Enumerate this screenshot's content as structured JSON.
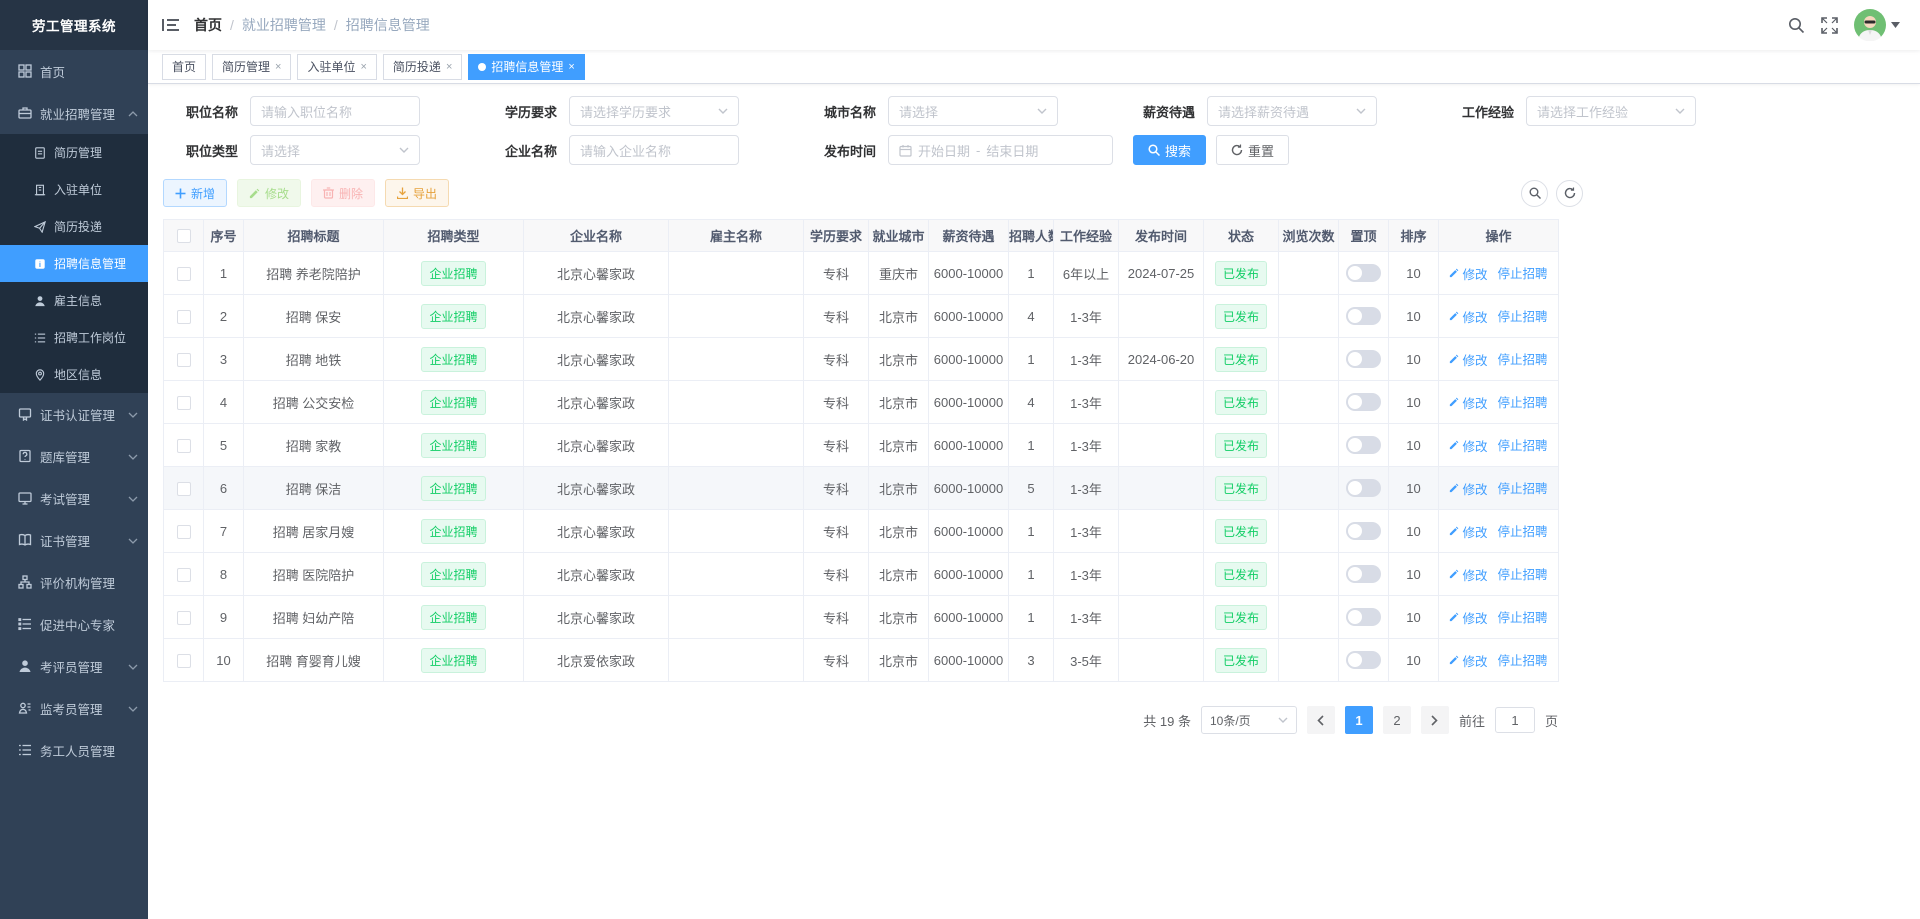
{
  "app": {
    "title": "劳工管理系统"
  },
  "theme": {
    "primary": "#409eff",
    "success": "#13ce66",
    "sidebar_bg": "#304156",
    "submenu_bg": "#1f2d3d"
  },
  "navbar": {
    "breadcrumb": [
      "首页",
      "就业招聘管理",
      "招聘信息管理"
    ],
    "icons": [
      "search-icon",
      "fullscreen-icon",
      "avatar",
      "caret-down-icon"
    ]
  },
  "tags": [
    {
      "label": "首页",
      "active": false,
      "closable": false
    },
    {
      "label": "简历管理",
      "active": false,
      "closable": true
    },
    {
      "label": "入驻单位",
      "active": false,
      "closable": true
    },
    {
      "label": "简历投递",
      "active": false,
      "closable": true
    },
    {
      "label": "招聘信息管理",
      "active": true,
      "closable": true
    }
  ],
  "sidebar": {
    "items": [
      {
        "label": "首页",
        "icon": "dashboard-icon",
        "chevron": null,
        "children": []
      },
      {
        "label": "就业招聘管理",
        "icon": "briefcase-icon",
        "chevron": "up",
        "children": [
          {
            "label": "简历管理",
            "icon": "resume-icon",
            "active": false
          },
          {
            "label": "入驻单位",
            "icon": "building-icon",
            "active": false
          },
          {
            "label": "简历投递",
            "icon": "send-icon",
            "active": false
          },
          {
            "label": "招聘信息管理",
            "icon": "info-icon",
            "active": true
          },
          {
            "label": "雇主信息",
            "icon": "user-icon",
            "active": false
          },
          {
            "label": "招聘工作岗位",
            "icon": "list-icon",
            "active": false
          },
          {
            "label": "地区信息",
            "icon": "region-icon",
            "active": false
          }
        ]
      },
      {
        "label": "证书认证管理",
        "icon": "certificate-icon",
        "chevron": "down",
        "children": []
      },
      {
        "label": "题库管理",
        "icon": "question-bank-icon",
        "chevron": "down",
        "children": []
      },
      {
        "label": "考试管理",
        "icon": "exam-icon",
        "chevron": "down",
        "children": []
      },
      {
        "label": "证书管理",
        "icon": "book-icon",
        "chevron": "down",
        "children": []
      },
      {
        "label": "评价机构管理",
        "icon": "org-chart-icon",
        "chevron": null,
        "children": []
      },
      {
        "label": "促进中心专家",
        "icon": "experts-icon",
        "chevron": null,
        "children": []
      },
      {
        "label": "考评员管理",
        "icon": "assessor-icon",
        "chevron": "down",
        "children": []
      },
      {
        "label": "监考员管理",
        "icon": "proctor-icon",
        "chevron": "down",
        "children": []
      },
      {
        "label": "务工人员管理",
        "icon": "workers-icon",
        "chevron": null,
        "children": []
      }
    ]
  },
  "filters": {
    "position_name": {
      "label": "职位名称",
      "placeholder": "请输入职位名称"
    },
    "education": {
      "label": "学历要求",
      "placeholder": "请选择学历要求"
    },
    "city": {
      "label": "城市名称",
      "placeholder": "请选择"
    },
    "salary": {
      "label": "薪资待遇",
      "placeholder": "请选择薪资待遇"
    },
    "experience": {
      "label": "工作经验",
      "placeholder": "请选择工作经验"
    },
    "position_type": {
      "label": "职位类型",
      "placeholder": "请选择"
    },
    "company": {
      "label": "企业名称",
      "placeholder": "请输入企业名称"
    },
    "publish_time": {
      "label": "发布时间",
      "start": "开始日期",
      "separator": "-",
      "end": "结束日期"
    },
    "search_label": "搜索",
    "reset_label": "重置"
  },
  "toolbar": {
    "add": "新增",
    "edit": "修改",
    "delete": "删除",
    "export": "导出"
  },
  "table": {
    "columns": [
      {
        "key": "index",
        "label": "序号"
      },
      {
        "key": "title",
        "label": "招聘标题"
      },
      {
        "key": "type",
        "label": "招聘类型"
      },
      {
        "key": "company",
        "label": "企业名称"
      },
      {
        "key": "employer",
        "label": "雇主名称"
      },
      {
        "key": "edu",
        "label": "学历要求"
      },
      {
        "key": "city",
        "label": "就业城市"
      },
      {
        "key": "salary",
        "label": "薪资待遇"
      },
      {
        "key": "count",
        "label": "招聘人数"
      },
      {
        "key": "exp",
        "label": "工作经验"
      },
      {
        "key": "date",
        "label": "发布时间"
      },
      {
        "key": "status",
        "label": "状态"
      },
      {
        "key": "views",
        "label": "浏览次数"
      },
      {
        "key": "top",
        "label": "置顶"
      },
      {
        "key": "sort",
        "label": "排序"
      },
      {
        "key": "ops",
        "label": "操作"
      }
    ],
    "ops": {
      "edit": "修改",
      "stop": "停止招聘"
    },
    "rows": [
      {
        "index": "1",
        "title": "招聘 养老院陪护",
        "type": "企业招聘",
        "company": "北京心馨家政",
        "employer": "",
        "edu": "专科",
        "city": "重庆市",
        "salary": "6000-10000",
        "count": "1",
        "exp": "6年以上",
        "date": "2024-07-25",
        "status": "已发布",
        "views": "",
        "sort": "10",
        "highlighted": false
      },
      {
        "index": "2",
        "title": "招聘 保安",
        "type": "企业招聘",
        "company": "北京心馨家政",
        "employer": "",
        "edu": "专科",
        "city": "北京市",
        "salary": "6000-10000",
        "count": "4",
        "exp": "1-3年",
        "date": "",
        "status": "已发布",
        "views": "",
        "sort": "10",
        "highlighted": false
      },
      {
        "index": "3",
        "title": "招聘 地铁",
        "type": "企业招聘",
        "company": "北京心馨家政",
        "employer": "",
        "edu": "专科",
        "city": "北京市",
        "salary": "6000-10000",
        "count": "1",
        "exp": "1-3年",
        "date": "2024-06-20",
        "status": "已发布",
        "views": "",
        "sort": "10",
        "highlighted": false
      },
      {
        "index": "4",
        "title": "招聘 公交安检",
        "type": "企业招聘",
        "company": "北京心馨家政",
        "employer": "",
        "edu": "专科",
        "city": "北京市",
        "salary": "6000-10000",
        "count": "4",
        "exp": "1-3年",
        "date": "",
        "status": "已发布",
        "views": "",
        "sort": "10",
        "highlighted": false
      },
      {
        "index": "5",
        "title": "招聘 家教",
        "type": "企业招聘",
        "company": "北京心馨家政",
        "employer": "",
        "edu": "专科",
        "city": "北京市",
        "salary": "6000-10000",
        "count": "1",
        "exp": "1-3年",
        "date": "",
        "status": "已发布",
        "views": "",
        "sort": "10",
        "highlighted": false
      },
      {
        "index": "6",
        "title": "招聘 保洁",
        "type": "企业招聘",
        "company": "北京心馨家政",
        "employer": "",
        "edu": "专科",
        "city": "北京市",
        "salary": "6000-10000",
        "count": "5",
        "exp": "1-3年",
        "date": "",
        "status": "已发布",
        "views": "",
        "sort": "10",
        "highlighted": true
      },
      {
        "index": "7",
        "title": "招聘 居家月嫂",
        "type": "企业招聘",
        "company": "北京心馨家政",
        "employer": "",
        "edu": "专科",
        "city": "北京市",
        "salary": "6000-10000",
        "count": "1",
        "exp": "1-3年",
        "date": "",
        "status": "已发布",
        "views": "",
        "sort": "10",
        "highlighted": false
      },
      {
        "index": "8",
        "title": "招聘 医院陪护",
        "type": "企业招聘",
        "company": "北京心馨家政",
        "employer": "",
        "edu": "专科",
        "city": "北京市",
        "salary": "6000-10000",
        "count": "1",
        "exp": "1-3年",
        "date": "",
        "status": "已发布",
        "views": "",
        "sort": "10",
        "highlighted": false
      },
      {
        "index": "9",
        "title": "招聘 妇幼产陪",
        "type": "企业招聘",
        "company": "北京心馨家政",
        "employer": "",
        "edu": "专科",
        "city": "北京市",
        "salary": "6000-10000",
        "count": "1",
        "exp": "1-3年",
        "date": "",
        "status": "已发布",
        "views": "",
        "sort": "10",
        "highlighted": false
      },
      {
        "index": "10",
        "title": "招聘 育婴育儿嫂",
        "type": "企业招聘",
        "company": "北京爱依家政",
        "employer": "",
        "edu": "专科",
        "city": "北京市",
        "salary": "6000-10000",
        "count": "3",
        "exp": "3-5年",
        "date": "",
        "status": "已发布",
        "views": "",
        "sort": "10",
        "highlighted": false
      }
    ]
  },
  "pagination": {
    "total_text": "共 19 条",
    "page_size": "10条/页",
    "pages": [
      "1",
      "2"
    ],
    "active_page": "1",
    "goto_prefix": "前往",
    "goto_value": "1",
    "goto_suffix": "页"
  }
}
